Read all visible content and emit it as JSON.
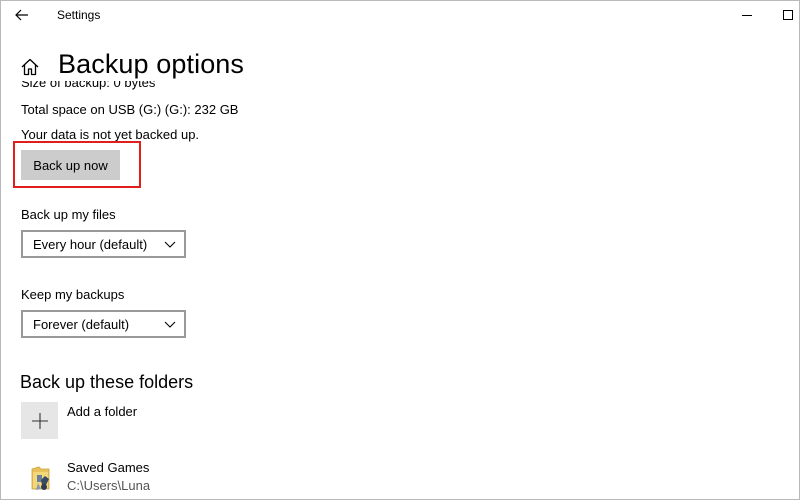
{
  "window": {
    "app_title": "Settings",
    "back_icon": "arrow-left-icon",
    "minimize_icon": "minimize-icon",
    "maximize_icon": "maximize-icon"
  },
  "header": {
    "home_icon": "home-icon",
    "title": "Backup options"
  },
  "overview": {
    "size_line_partial": "Size of backup: 0 bytes",
    "total_space": "Total space on USB (G:) (G:): 232 GB",
    "status": "Your data is not yet backed up.",
    "backup_button_label": "Back up now"
  },
  "settings": {
    "backup_frequency": {
      "label": "Back up my files",
      "selected": "Every hour (default)"
    },
    "keep_backups": {
      "label": "Keep my backups",
      "selected": "Forever (default)"
    }
  },
  "folders": {
    "section_title": "Back up these folders",
    "add_label": "Add a folder",
    "add_icon": "plus-icon",
    "items": [
      {
        "name": "Saved Games",
        "path": "C:\\Users\\Luna",
        "icon": "saved-games-folder-icon"
      }
    ]
  },
  "colors": {
    "highlight": "#e01e1e",
    "button_bg": "#cccccc",
    "add_tile_bg": "#e6e6e6"
  }
}
